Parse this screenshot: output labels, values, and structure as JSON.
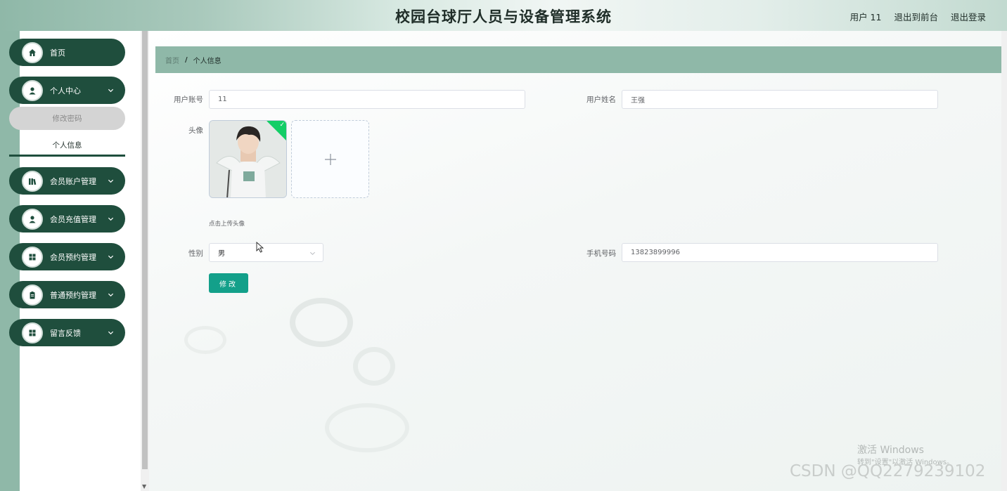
{
  "header": {
    "title": "校园台球厅人员与设备管理系统",
    "user_label": "用户 11",
    "front_link": "退出到前台",
    "logout_link": "退出登录"
  },
  "sidebar": {
    "items": [
      {
        "label": "首页",
        "icon": "home-icon"
      },
      {
        "label": "个人中心",
        "icon": "user-icon"
      },
      {
        "label": "会员账户管理",
        "icon": "books-icon"
      },
      {
        "label": "会员充值管理",
        "icon": "user-icon"
      },
      {
        "label": "会员预约管理",
        "icon": "grid-icon"
      },
      {
        "label": "普通预约管理",
        "icon": "clipboard-icon"
      },
      {
        "label": "留言反馈",
        "icon": "grid-icon"
      }
    ],
    "sub_items": {
      "change_password": "修改密码",
      "personal_info": "个人信息"
    }
  },
  "breadcrumb": {
    "home": "首页",
    "separator": "/",
    "current": "个人信息"
  },
  "form": {
    "account_label": "用户账号",
    "account_value": "11",
    "name_label": "用户姓名",
    "name_value": "王强",
    "avatar_label": "头像",
    "upload_tip": "点击上传头像",
    "gender_label": "性别",
    "gender_value": "男",
    "phone_label": "手机号码",
    "phone_value": "13823899996",
    "submit_label": "修改"
  },
  "watermarks": {
    "activate_title": "激活 Windows",
    "activate_sub": "转到\"设置\"以激活 Windows。",
    "csdn": "CSDN @QQ2279239102"
  },
  "colors": {
    "accent": "#8fb8a8",
    "menu_bg": "#1f4e3d",
    "button": "#13a08a"
  }
}
